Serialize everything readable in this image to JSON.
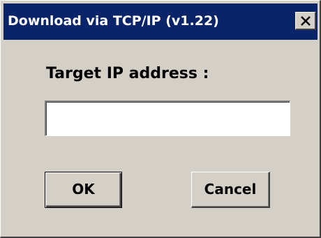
{
  "window": {
    "title": "Download via TCP/IP (v1.22)",
    "close_icon": "close-x-icon"
  },
  "form": {
    "label": "Target IP address :",
    "ip_value": "",
    "ip_placeholder": ""
  },
  "buttons": {
    "ok_label": "OK",
    "cancel_label": "Cancel"
  },
  "colors": {
    "titlebar": "#0a246a",
    "face": "#d4d0c8",
    "input_bg": "#ffffff"
  }
}
